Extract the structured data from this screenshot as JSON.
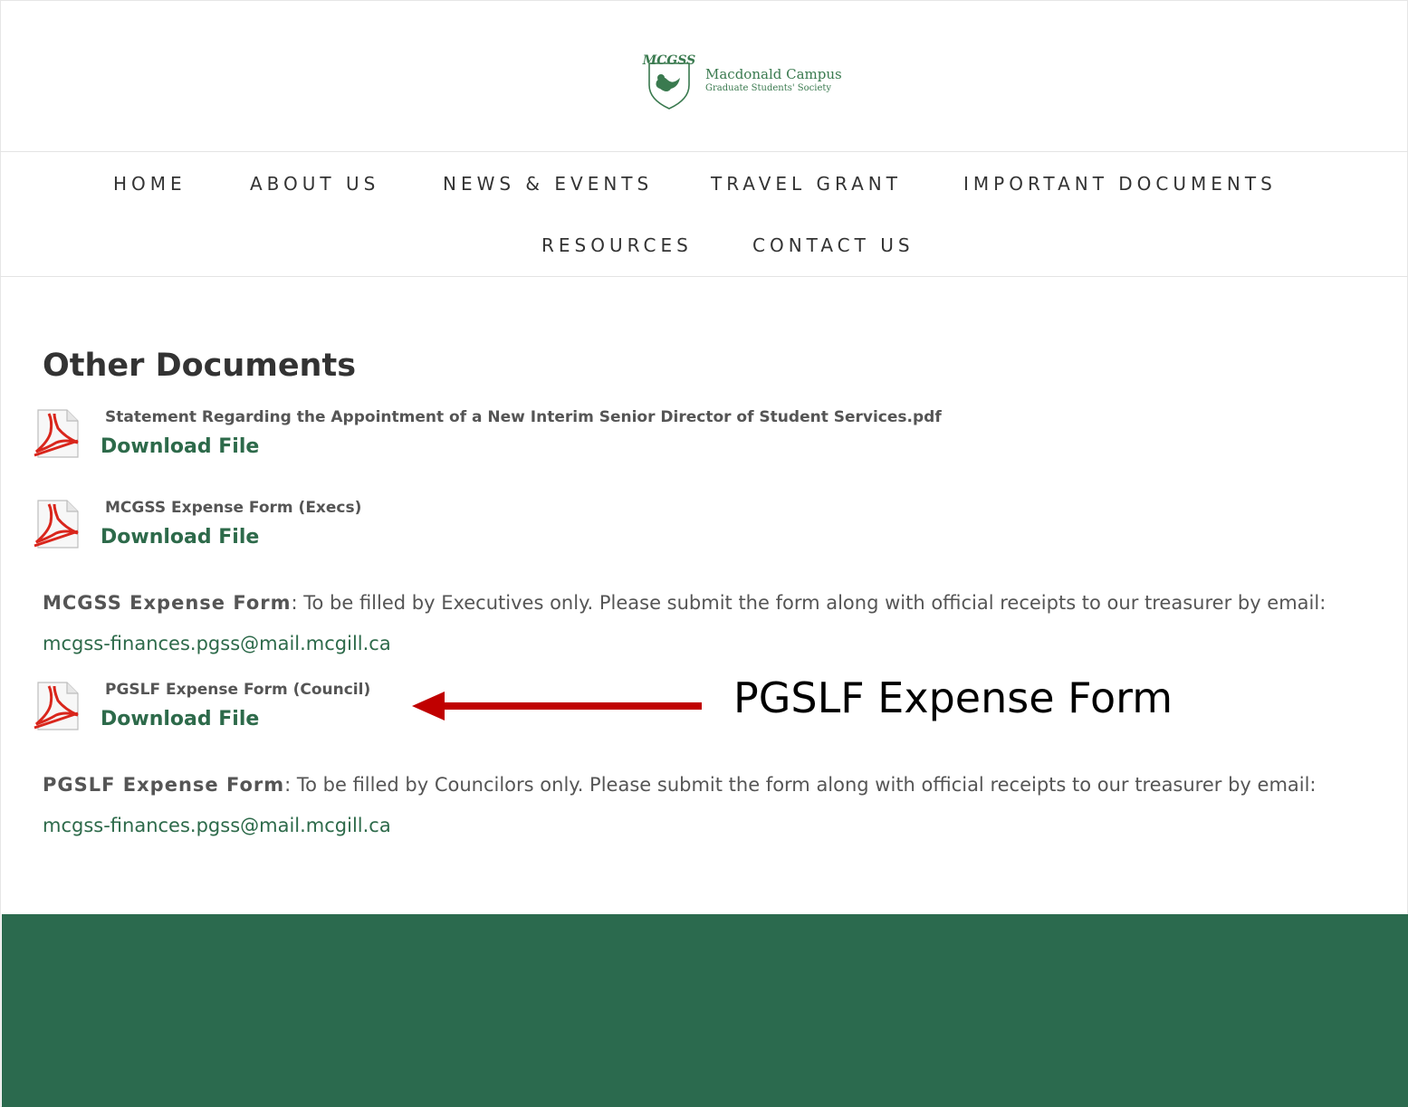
{
  "logo": {
    "acronym": "MCGSS",
    "name": "Macdonald Campus",
    "subtitle": "Graduate Students' Society"
  },
  "nav": {
    "items": [
      {
        "label": "HOME"
      },
      {
        "label": "ABOUT US"
      },
      {
        "label": "NEWS & EVENTS"
      },
      {
        "label": "TRAVEL GRANT"
      },
      {
        "label": "IMPORTANT DOCUMENTS"
      },
      {
        "label": "RESOURCES"
      },
      {
        "label": "CONTACT US"
      }
    ]
  },
  "content": {
    "title": "Other Documents",
    "documents": [
      {
        "name": "Statement Regarding the Appointment of a New Interim Senior Director of Student Services.pdf",
        "link": "Download File"
      },
      {
        "name": "MCGSS Expense Form (Execs)",
        "link": "Download File"
      },
      {
        "name": "PGSLF Expense Form (Council)",
        "link": "Download File"
      }
    ],
    "notes": [
      {
        "lead": "MCGSS Expense Form",
        "text": ": To be filled by Executives only. Please submit the form along with official receipts to our treasurer by email: ",
        "email": "mcgss-finances.pgss@mail.mcgill.ca"
      },
      {
        "lead": "PGSLF Expense Form",
        "text": ": To be filled by Councilors only. Please submit the form along with official receipts to our treasurer by email: ",
        "email": "mcgss-finances.pgss@mail.mcgill.ca"
      }
    ]
  },
  "annotation": {
    "label": "PGSLF Expense Form",
    "arrow_color": "#c00000"
  },
  "colors": {
    "brand_green": "#2b6a4e",
    "link_green": "#2d6a4a",
    "logo_green": "#3a7a4f",
    "pdf_red": "#d9261c"
  }
}
